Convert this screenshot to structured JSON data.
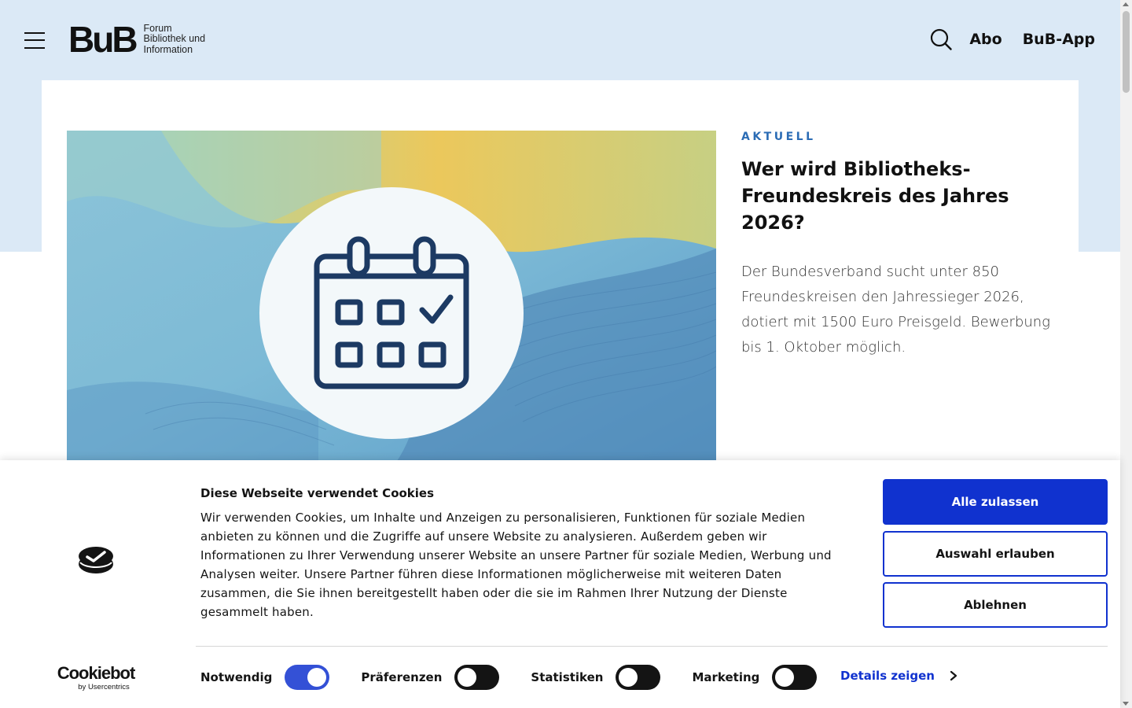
{
  "header": {
    "logo_mark": "BuB",
    "logo_lines": [
      "Forum",
      "Bibliothek und",
      "Information"
    ],
    "nav": [
      "Abo",
      "BuB-App"
    ]
  },
  "teaser": {
    "kicker": "AKTUELL",
    "headline": "Wer wird Bibliotheks-Freundeskreis des Jahres 2026?",
    "body": "Der Bundesverband sucht unter 850 Freundeskreisen den Jahressieger 2026, dotiert mit 1500 Euro Preisgeld. Bewerbung bis 1. Oktober möglich."
  },
  "cookie_banner": {
    "title": "Diese Webseite verwendet Cookies",
    "text": "Wir verwenden Cookies, um Inhalte und Anzeigen zu personalisieren, Funktionen für soziale Medien anbieten zu können und die Zugriffe auf unsere Website zu analysieren. Außerdem geben wir Informationen zu Ihrer Verwendung unserer Website an unsere Partner für soziale Medien, Werbung und Analysen weiter. Unsere Partner führen diese Informationen möglicherweise mit weiteren Daten zusammen, die Sie ihnen bereitgestellt haben oder die sie im Rahmen Ihrer Nutzung der Dienste gesammelt haben.",
    "buttons": {
      "allow_all": "Alle zulassen",
      "allow_selection": "Auswahl erlauben",
      "deny": "Ablehnen"
    },
    "brand_name": "Cookiebot",
    "brand_sub": "by Usercentrics",
    "toggles": [
      {
        "label": "Notwendig",
        "on": true
      },
      {
        "label": "Präferenzen",
        "on": false
      },
      {
        "label": "Statistiken",
        "on": false
      },
      {
        "label": "Marketing",
        "on": false
      }
    ],
    "details_label": "Details zeigen"
  },
  "colors": {
    "accent": "#1032cf",
    "kicker": "#2b6cb5",
    "hero_bg": "#dbe9f6"
  }
}
